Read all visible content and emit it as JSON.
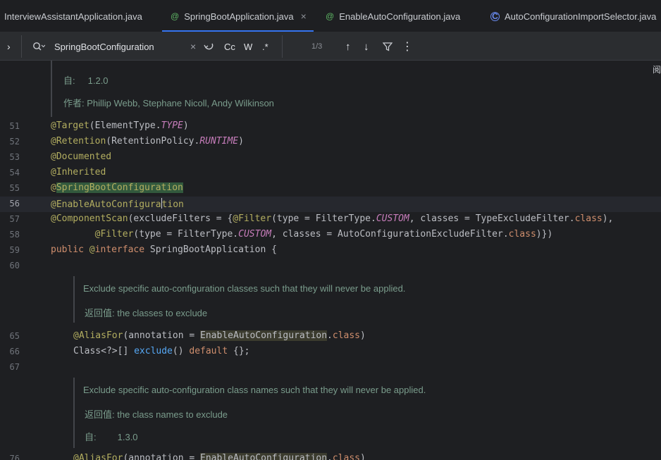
{
  "tabs": [
    {
      "label": "InterviewAssistantApplication.java",
      "icon": "none",
      "active": false
    },
    {
      "label": "SpringBootApplication.java",
      "icon": "annotation-icon",
      "active": true
    },
    {
      "label": "EnableAutoConfiguration.java",
      "icon": "annotation-icon",
      "active": false
    },
    {
      "label": "AutoConfigurationImportSelector.java",
      "icon": "class-icon",
      "active": false
    }
  ],
  "findbar": {
    "query": "SpringBootConfiguration",
    "match_count": "1/3",
    "cc": "Cc",
    "w": "W",
    "regex": ".*"
  },
  "editor": {
    "reader_mode": "阅",
    "doc1": {
      "since_label": "自:",
      "since_value": "1.2.0",
      "author": "作者: Phillip Webb, Stephane Nicoll, Andy Wilkinson"
    },
    "doc2": {
      "text": "Exclude specific auto-configuration classes such that they will never be applied.",
      "returns": "返回值: the classes to exclude"
    },
    "doc3": {
      "text": "Exclude specific auto-configuration class names such that they will never be applied.",
      "returns": "返回值: the class names to exclude",
      "since_label": "自:",
      "since_value": "1.3.0"
    },
    "line_numbers": [
      "51",
      "52",
      "53",
      "54",
      "55",
      "56",
      "57",
      "58",
      "59",
      "60",
      "65",
      "66",
      "67",
      "76"
    ]
  }
}
